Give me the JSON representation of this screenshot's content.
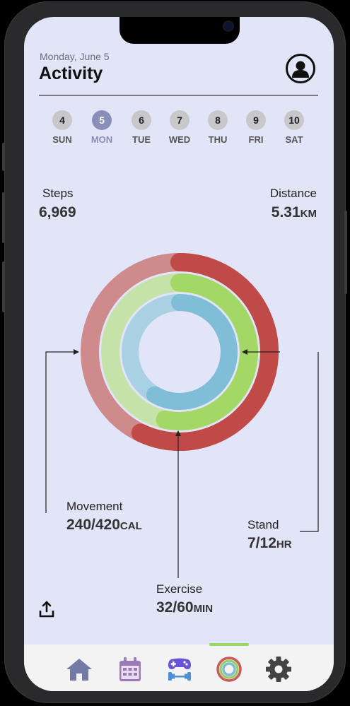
{
  "header": {
    "date": "Monday, June 5",
    "title": "Activity"
  },
  "week": [
    {
      "num": "4",
      "label": "SUN",
      "selected": false
    },
    {
      "num": "5",
      "label": "MON",
      "selected": true
    },
    {
      "num": "6",
      "label": "TUE",
      "selected": false
    },
    {
      "num": "7",
      "label": "WED",
      "selected": false
    },
    {
      "num": "8",
      "label": "THU",
      "selected": false
    },
    {
      "num": "9",
      "label": "FRI",
      "selected": false
    },
    {
      "num": "10",
      "label": "SAT",
      "selected": false
    }
  ],
  "stats": {
    "steps_label": "Steps",
    "steps_value": "6,969",
    "distance_label": "Distance",
    "distance_value": "5.31",
    "distance_unit": "KM",
    "movement_label": "Movement",
    "movement_value": "240/420",
    "movement_unit": "CAL",
    "exercise_label": "Exercise",
    "exercise_value": "32/60",
    "exercise_unit": "MIN",
    "stand_label": "Stand",
    "stand_value": "7/12",
    "stand_unit": "HR"
  },
  "rings": {
    "movement": {
      "current": 240,
      "goal": 420,
      "color": "#bf4a48",
      "track": "#cf8a8c"
    },
    "exercise": {
      "current": 32,
      "goal": 60,
      "color": "#a4d866",
      "track": "#c5e2a8"
    },
    "stand": {
      "current": 7,
      "goal": 12,
      "color": "#80bdd6",
      "track": "#a9d0e3"
    }
  },
  "nav": {
    "items": [
      "home-icon",
      "calendar-icon",
      "gamepad-dumbbell-icon",
      "activity-rings-icon",
      "gear-icon"
    ],
    "active": "activity-rings-icon",
    "accent": "#9bd86a"
  },
  "colors": {
    "background": "#e2e4f7",
    "selected_day": "#8a8fb8"
  }
}
